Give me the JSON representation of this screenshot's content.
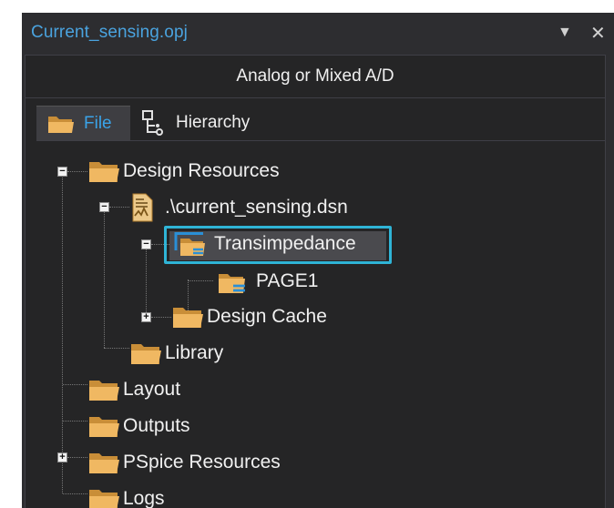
{
  "window": {
    "title": "Current_sensing.opj",
    "dropdown_glyph": "▼",
    "close_glyph": "✕"
  },
  "mode": "Analog or Mixed A/D",
  "tabs": [
    {
      "label": "File",
      "icon": "folder-icon",
      "active": true
    },
    {
      "label": "Hierarchy",
      "icon": "hierarchy-icon",
      "active": false
    }
  ],
  "tree": {
    "design_resources": "Design Resources",
    "design_file": ".\\current_sensing.dsn",
    "schematic": "Transimpedance",
    "page": "PAGE1",
    "design_cache": "Design Cache",
    "library": "Library",
    "layout": "Layout",
    "outputs": "Outputs",
    "pspice_resources": "PSpice Resources",
    "logs": "Logs"
  },
  "expander_glyphs": {
    "collapse": "−",
    "expand": "+"
  },
  "colors": {
    "panel_bg": "#2d2d30",
    "tree_bg": "#252526",
    "title_text": "#4aa3df",
    "active_tab_text": "#3aa3e8",
    "highlight": "#2fb4d6",
    "folder": "#e8b15a"
  }
}
